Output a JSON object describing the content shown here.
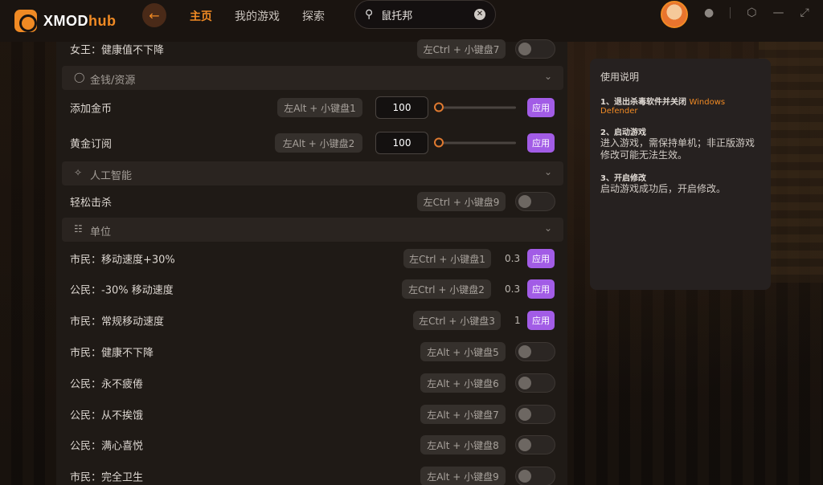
{
  "app": {
    "logo_prefix": "XMOD",
    "logo_suffix": "hub"
  },
  "nav": {
    "home": "主页",
    "my_games": "我的游戏",
    "explore": "探索"
  },
  "search": {
    "value": "鼠托邦"
  },
  "icons": {
    "back": "back-arrow-icon",
    "search": "search-icon",
    "clear": "clear-icon",
    "bell": "bell-icon",
    "settings": "gear-icon",
    "minimize": "minimize-icon",
    "maximize": "maximize-icon"
  },
  "colors": {
    "accent": "#f08a24",
    "apply": "#a25ce6",
    "panel": "#1f1a16"
  },
  "rows": {
    "r0": {
      "label": "女王：健康值不下降",
      "hotkey": "左Ctrl + 小键盘7"
    },
    "sec_money": {
      "title": "金钱/资源"
    },
    "r1": {
      "label": "添加金币",
      "hotkey": "左Alt + 小键盘1",
      "value": "100",
      "apply": "应用"
    },
    "r2": {
      "label": "黄金订阅",
      "hotkey": "左Alt + 小键盘2",
      "value": "100",
      "apply": "应用"
    },
    "sec_ai": {
      "title": "人工智能"
    },
    "r3": {
      "label": "轻松击杀",
      "hotkey": "左Ctrl + 小键盘9"
    },
    "sec_unit": {
      "title": "单位"
    },
    "r4": {
      "label": "市民：移动速度+30%",
      "hotkey": "左Ctrl + 小键盘1",
      "value": "0.3",
      "apply": "应用"
    },
    "r5": {
      "label": "公民：-30% 移动速度",
      "hotkey": "左Ctrl + 小键盘2",
      "value": "0.3",
      "apply": "应用"
    },
    "r6": {
      "label": "市民：常规移动速度",
      "hotkey": "左Ctrl + 小键盘3",
      "value": "1",
      "apply": "应用"
    },
    "r7": {
      "label": "市民：健康不下降",
      "hotkey": "左Alt + 小键盘5"
    },
    "r8": {
      "label": "公民：永不疲倦",
      "hotkey": "左Alt + 小键盘6"
    },
    "r9": {
      "label": "公民：从不挨饿",
      "hotkey": "左Alt + 小键盘7"
    },
    "r10": {
      "label": "公民：满心喜悦",
      "hotkey": "左Alt + 小键盘8"
    },
    "r11": {
      "label": "市民：完全卫生",
      "hotkey": "左Alt + 小键盘9"
    }
  },
  "guide": {
    "title": "使用说明",
    "step1_head": "1、退出杀毒软件并关闭",
    "step1_highlight": "Windows Defender",
    "step2_head": "2、启动游戏",
    "step2_body": "进入游戏，需保持单机；非正版游戏修改可能无法生效。",
    "step3_head": "3、开启修改",
    "step3_body": "启动游戏成功后，开启修改。"
  }
}
